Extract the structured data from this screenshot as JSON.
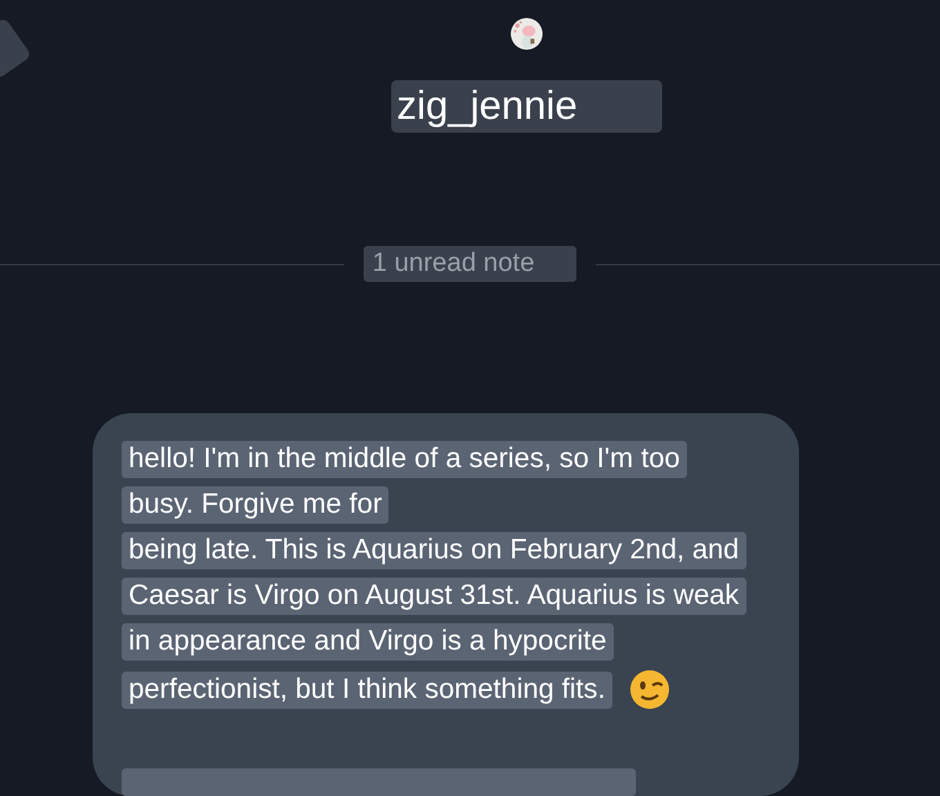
{
  "profile": {
    "username": "zig_jennie"
  },
  "divider": {
    "label": "1 unread note"
  },
  "message": {
    "lines": [
      "hello! I'm in the middle of a series, so I'm too",
      "busy. Forgive me for",
      "being late. This is Aquarius on February 2nd, and",
      "Caesar is Virgo on August 31st. Aquarius is weak",
      "in appearance and Virgo is a hypocrite",
      "perfectionist, but I think something fits."
    ],
    "ends_with_emoji": true
  }
}
